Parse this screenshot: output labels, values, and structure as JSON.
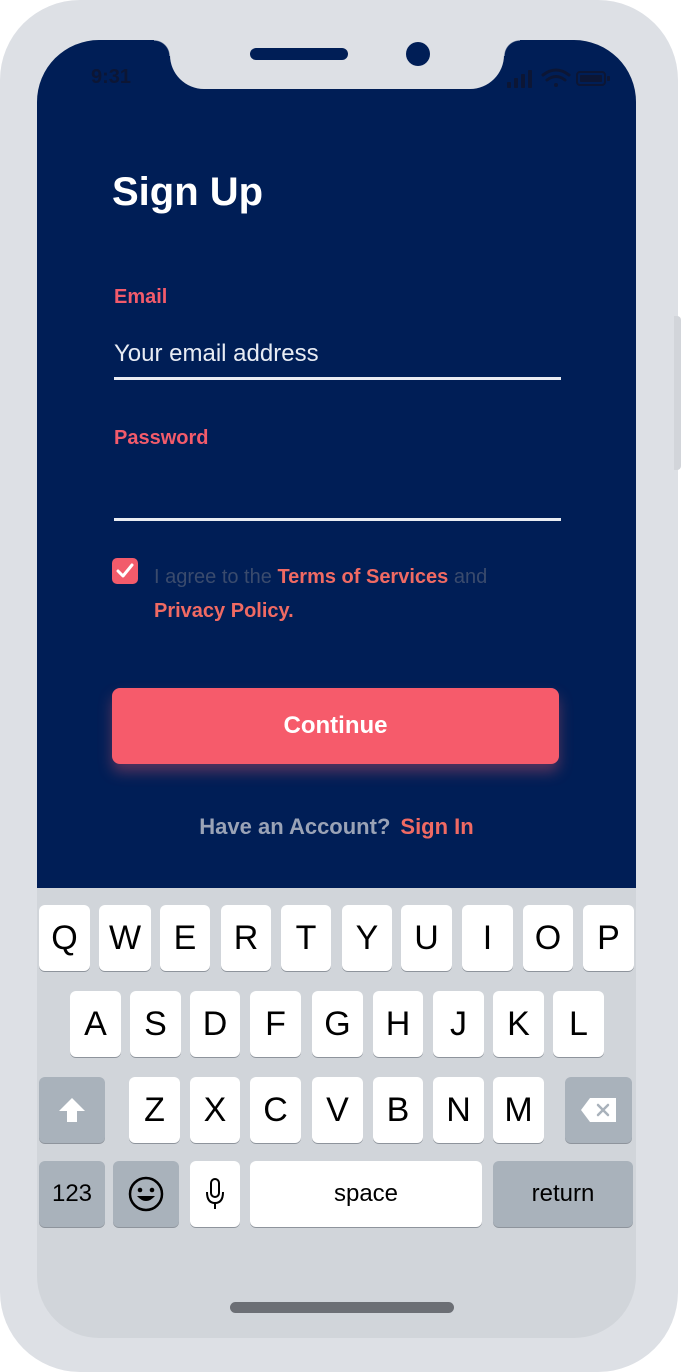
{
  "status_bar": {
    "time": "9:31",
    "icons": [
      "signal-icon",
      "wifi-icon",
      "battery-icon"
    ]
  },
  "colors": {
    "accent": "#f25b6b",
    "background": "#001e56",
    "button": "#f65b6b"
  },
  "form": {
    "title": "Sign Up",
    "email_label": "Email",
    "email_placeholder": "Your email address",
    "password_label": "Password",
    "password_value": "",
    "agree_checked": true,
    "agree_prefix": "I agree to the",
    "terms_link": "Terms of Services",
    "agree_and": "and",
    "privacy_link": "Privacy Policy.",
    "continue_label": "Continue",
    "have_account": "Have an Account?",
    "sign_in_label": "Sign In"
  },
  "keyboard": {
    "row1": [
      "Q",
      "W",
      "E",
      "R",
      "T",
      "Y",
      "U",
      "I",
      "O",
      "P"
    ],
    "row2": [
      "A",
      "S",
      "D",
      "F",
      "G",
      "H",
      "J",
      "K",
      "L"
    ],
    "row3": [
      "Z",
      "X",
      "C",
      "V",
      "B",
      "N",
      "M"
    ],
    "numbers_label": "123",
    "space_label": "space",
    "return_label": "return"
  }
}
